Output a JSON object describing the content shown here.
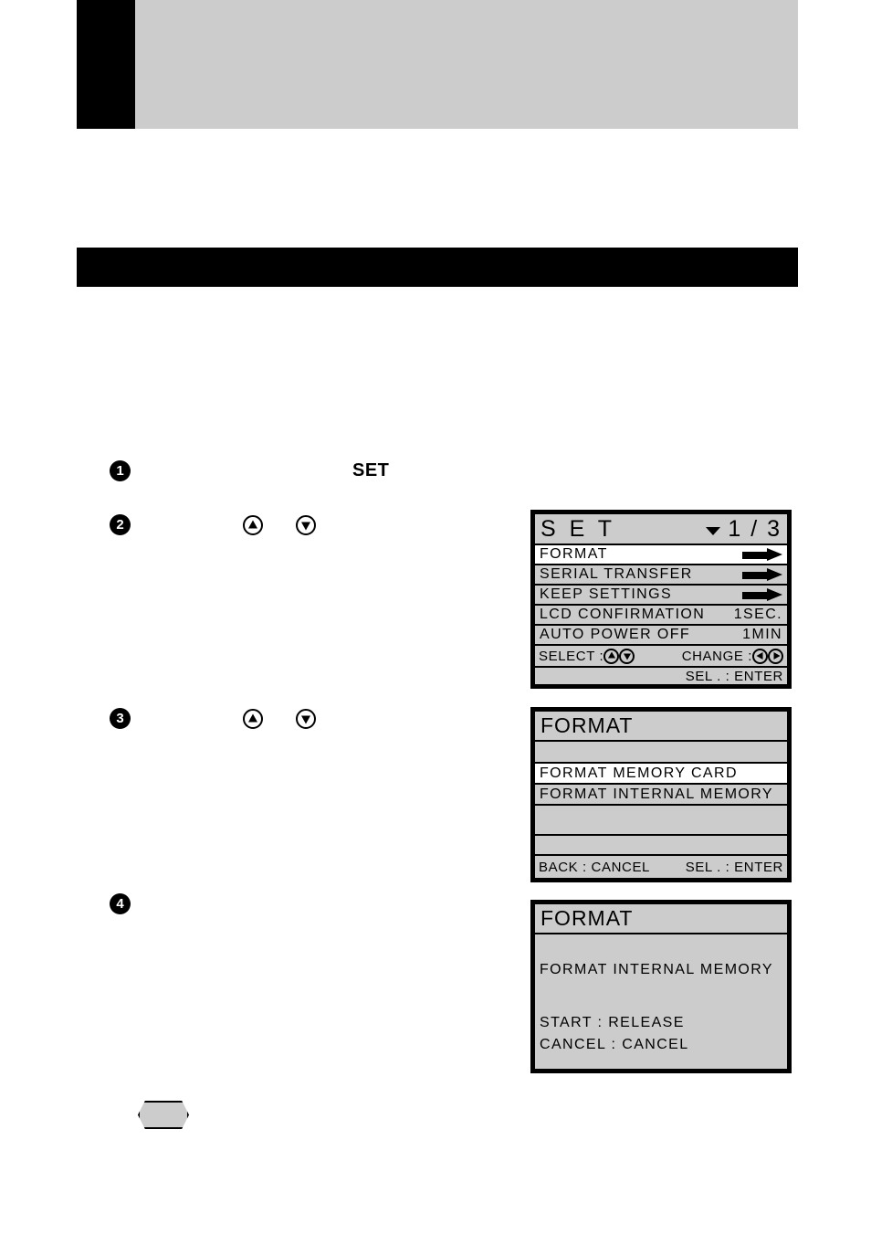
{
  "page": {
    "chapter_tab_label": "",
    "header_title": "",
    "section_title": "",
    "intro_text": ""
  },
  "steps": [
    {
      "number": "1",
      "pre_text": "",
      "button": "SET",
      "post_text": "",
      "keys": []
    },
    {
      "number": "2",
      "pre_text": "",
      "button": "",
      "post_text": "",
      "keys": [
        "up",
        "down"
      ]
    },
    {
      "number": "3",
      "pre_text": "",
      "button": "",
      "post_text": "",
      "keys": [
        "up",
        "down"
      ]
    },
    {
      "number": "4",
      "pre_text": "",
      "button": "",
      "post_text": "",
      "keys": []
    }
  ],
  "note": {
    "badge": "",
    "text": ""
  },
  "lcd_set_menu": {
    "title": "S E T",
    "page_indicator": "1 / 3",
    "rows": [
      {
        "label": "FORMAT",
        "value": "arrow",
        "selected": true
      },
      {
        "label": "SERIAL  TRANSFER",
        "value": "arrow",
        "selected": false
      },
      {
        "label": "KEEP  SETTINGS",
        "value": "arrow",
        "selected": false
      },
      {
        "label": "LCD  CONFIRMATION",
        "value": "1SEC.",
        "selected": false
      },
      {
        "label": "AUTO  POWER  OFF",
        "value": "1MIN",
        "selected": false
      }
    ],
    "footer_select_label": "SELECT :",
    "footer_change_label": "CHANGE :",
    "footer_enter_label": "SEL . : ENTER"
  },
  "lcd_format_menu": {
    "title": "FORMAT",
    "rows": [
      {
        "label": "FORMAT  MEMORY  CARD",
        "selected": true
      },
      {
        "label": "FORMAT  INTERNAL  MEMORY",
        "selected": false
      }
    ],
    "footer_back_label": "BACK : CANCEL",
    "footer_enter_label": "SEL . : ENTER"
  },
  "lcd_format_confirm": {
    "title": "FORMAT",
    "message": "FORMAT  INTERNAL  MEMORY",
    "start_line": "START : RELEASE",
    "cancel_line": "CANCEL : CANCEL"
  },
  "colors": {
    "lcd_background": "#cccccc",
    "lcd_selected": "#ffffff",
    "ink": "#000000",
    "header_band": "#cccccc"
  }
}
